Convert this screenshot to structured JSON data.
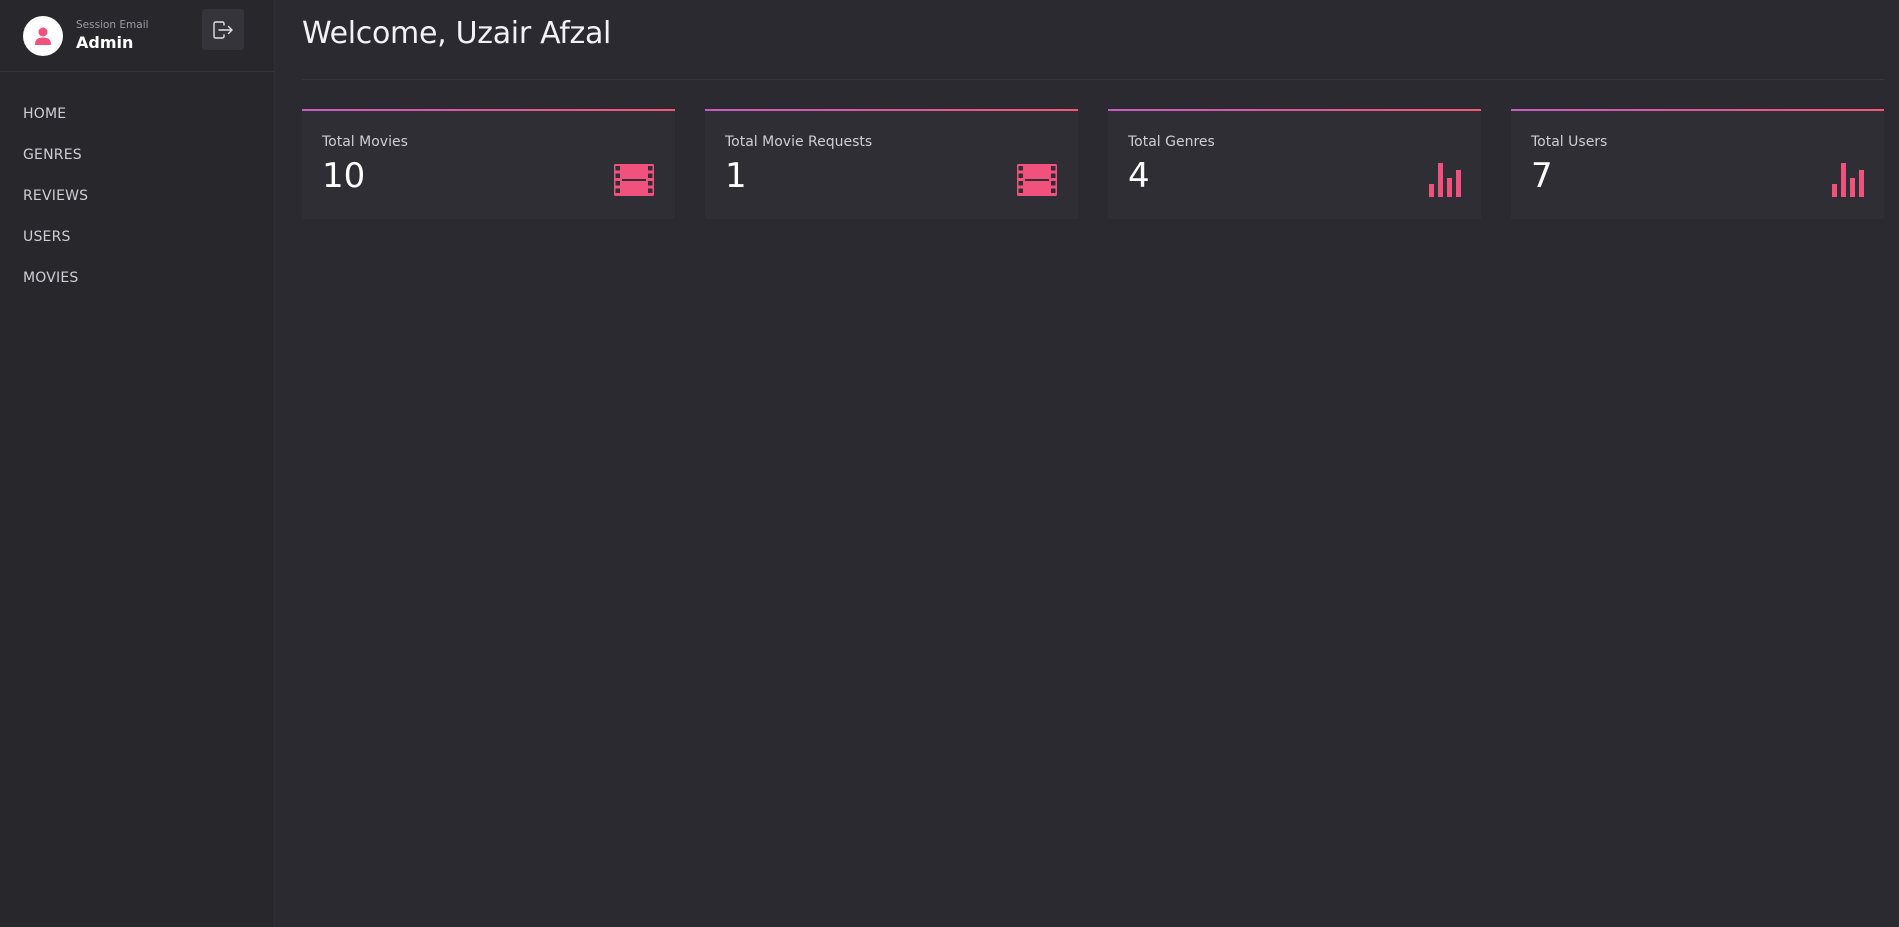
{
  "sidebar": {
    "session_label": "Session Email",
    "session_name": "Admin",
    "icons": {
      "avatar": "user-icon",
      "logout": "logout-icon"
    },
    "nav": [
      {
        "label": "HOME"
      },
      {
        "label": "GENRES"
      },
      {
        "label": "REVIEWS"
      },
      {
        "label": "USERS"
      },
      {
        "label": "MOVIES"
      }
    ]
  },
  "header": {
    "title": "Welcome, Uzair Afzal"
  },
  "stats": [
    {
      "label": "Total Movies",
      "value": "10",
      "icon": "film-icon"
    },
    {
      "label": "Total Movie Requests",
      "value": "1",
      "icon": "film-icon"
    },
    {
      "label": "Total Genres",
      "value": "4",
      "icon": "bar-chart-icon"
    },
    {
      "label": "Total Users",
      "value": "7",
      "icon": "bar-chart-icon"
    }
  ],
  "colors": {
    "accent": "#f0527d",
    "background": "#2b2a30",
    "sidebar": "#28272c",
    "card": "#2f2e34"
  }
}
